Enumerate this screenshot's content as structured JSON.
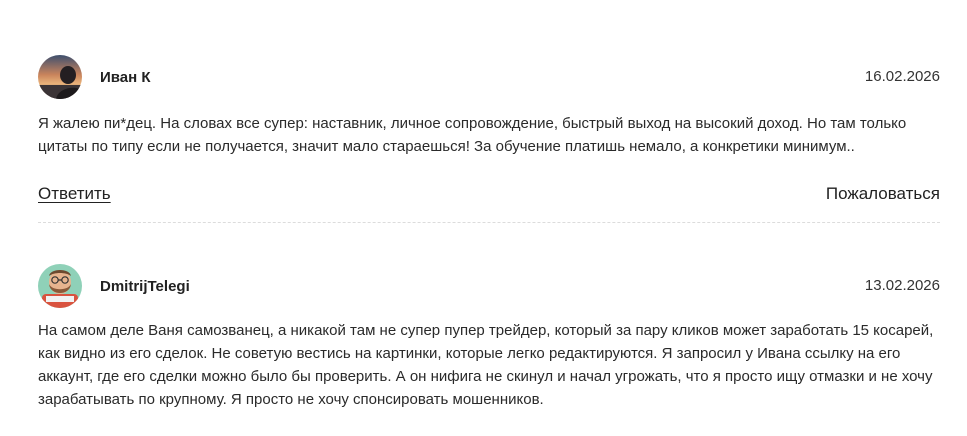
{
  "comments": [
    {
      "author": "Иван К",
      "date": "16.02.2026",
      "text": "Я жалею пи*дец. На словах все супер: наставник, личное сопровождение, быстрый выход на высокий доход. Но там только цитаты по типу если не получается, значит мало стараешься! За обучение платишь немало, а конкретики минимум..",
      "avatar": "sunset-portrait-avatar"
    },
    {
      "author": "DmitrijTelegi",
      "date": "13.02.2026",
      "text": "На самом деле Ваня самозванец, а никакой там не супер пупер трейдер, который за пару кликов может заработать 15 косарей, как видно из его сделок. Не советую вестись на картинки, которые легко редактируются. Я запросил у Ивана ссылку на его аккаунт, где его сделки можно было бы проверить. А он нифига не скинул и начал угрожать, что я просто ищу отмазки и не хочу зарабатывать по крупному. Я просто не хочу спонсировать мошенников.",
      "avatar": "cartoon-bearded-man-avatar"
    }
  ],
  "actions": {
    "reply_label": "Ответить",
    "report_label": "Пожаловаться"
  }
}
